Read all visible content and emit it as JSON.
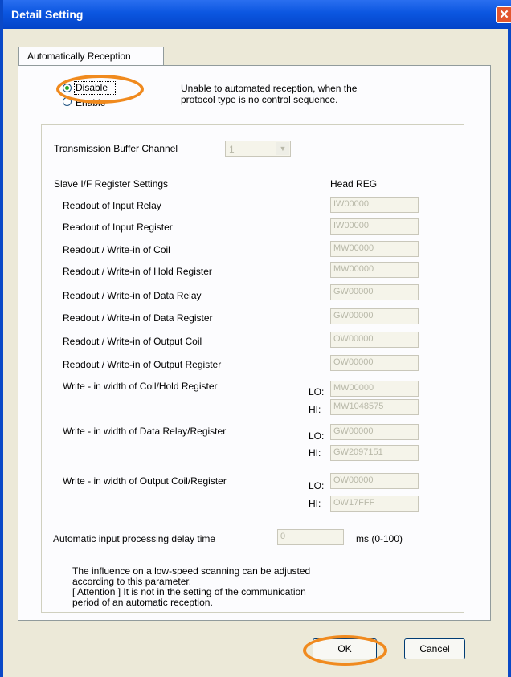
{
  "window": {
    "title": "Detail Setting",
    "close_glyph": "✕"
  },
  "tabs": [
    {
      "label": "Automatically Reception"
    }
  ],
  "reception": {
    "disable_label": "Disable",
    "enable_label": "Enable",
    "selected": "Disable",
    "note_line1": "Unable to automated reception, when the",
    "note_line2": "protocol type is no control sequence."
  },
  "buffer_channel": {
    "label": "Transmission Buffer Channel",
    "value": "1",
    "arrow": "▼"
  },
  "registers": {
    "section_label": "Slave I/F Register Settings",
    "head_label": "Head REG",
    "rows": [
      {
        "label": "Readout of Input Relay",
        "value": "IW00000"
      },
      {
        "label": "Readout of Input Register",
        "value": "IW00000"
      },
      {
        "label": "Readout / Write-in of Coil",
        "value": "MW00000"
      },
      {
        "label": "Readout / Write-in of Hold Register",
        "value": "MW00000"
      },
      {
        "label": "Readout / Write-in of Data Relay",
        "value": "GW00000"
      },
      {
        "label": "Readout / Write-in of Data Register",
        "value": "GW00000"
      },
      {
        "label": "Readout / Write-in of Output Coil",
        "value": "OW00000"
      },
      {
        "label": "Readout / Write-in of Output Register",
        "value": "OW00000"
      }
    ],
    "widths": [
      {
        "label": "Write - in width of Coil/Hold Register",
        "lo_label": "LO:",
        "lo": "MW00000",
        "hi_label": "HI:",
        "hi": "MW1048575"
      },
      {
        "label": "Write - in width of Data Relay/Register",
        "lo_label": "LO:",
        "lo": "GW00000",
        "hi_label": "HI:",
        "hi": "GW2097151"
      },
      {
        "label": "Write - in width of Output Coil/Register",
        "lo_label": "LO:",
        "lo": "OW00000",
        "hi_label": "HI:",
        "hi": "OW17FFF"
      }
    ]
  },
  "delay": {
    "label": "Automatic input processing delay time",
    "value": "0",
    "unit": "ms (0-100)"
  },
  "info": {
    "line1": "The influence on a low-speed scanning can be adjusted",
    "line2": "according to this parameter.",
    "line3": "[ Attention ] It is not in the setting of the communication",
    "line4": "period of an automatic reception."
  },
  "buttons": {
    "ok": "OK",
    "cancel": "Cancel"
  },
  "colors": {
    "title_bar": "#0b56e0",
    "highlight_ring": "#f08a1e",
    "close": "#e2562f"
  }
}
